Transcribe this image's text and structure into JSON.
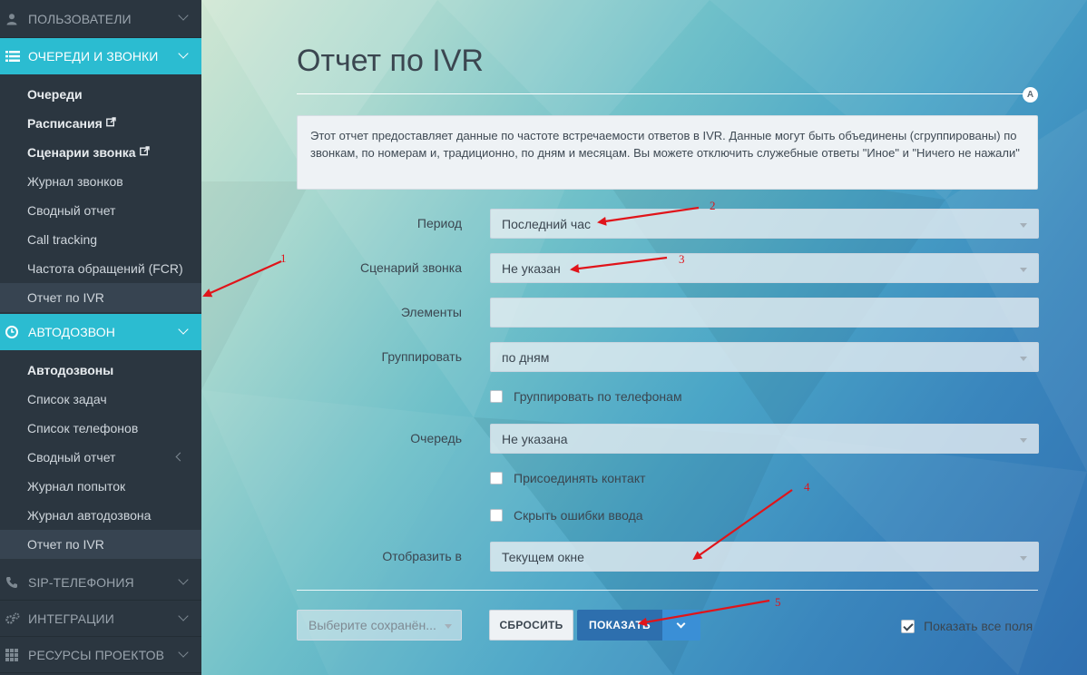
{
  "sidebar": {
    "sections": [
      {
        "label": "ПОЛЬЗОВАТЕЛИ",
        "icon": "user-icon"
      },
      {
        "label": "ОЧЕРЕДИ И ЗВОНКИ",
        "icon": "list-icon"
      },
      {
        "label": "АВТОДОЗВОН",
        "icon": "clock-icon"
      },
      {
        "label": "SIP-ТЕЛЕФОНИЯ",
        "icon": "phone-icon"
      },
      {
        "label": "ИНТЕГРАЦИИ",
        "icon": "cogs-icon"
      },
      {
        "label": "РЕСУРСЫ ПРОЕКТОВ",
        "icon": "grid-icon"
      }
    ],
    "queues_items": [
      "Очереди",
      "Расписания",
      "Сценарии звонка",
      "Журнал звонков",
      "Сводный отчет",
      "Call tracking",
      "Частота обращений (FCR)",
      "Отчет по IVR"
    ],
    "autodial_items": [
      "Автодозвоны",
      "Список задач",
      "Список телефонов",
      "Сводный отчет",
      "Журнал попыток",
      "Журнал автодозвона",
      "Отчет по IVR"
    ],
    "external_link_icon": "external-link-icon"
  },
  "page": {
    "title": "Отчет по IVR",
    "badge": "A",
    "description": "Этот отчет предоставляет данные по частоте встречаемости ответов в IVR. Данные могут быть объединены (сгруппированы) по звонкам, по номерам и, традиционно, по дням и месяцам. Вы можете отключить служебные ответы \"Иное\" и \"Ничего не нажали\""
  },
  "form": {
    "period_label": "Период",
    "period_value": "Последний час",
    "scenario_label": "Сценарий звонка",
    "scenario_value": "Не указан",
    "elements_label": "Элементы",
    "elements_value": "",
    "group_label": "Группировать",
    "group_value": "по дням",
    "group_by_phone": "Группировать по телефонам",
    "queue_label": "Очередь",
    "queue_value": "Не указана",
    "attach_contact": "Присоединять контакт",
    "hide_errors": "Скрыть ошибки ввода",
    "display_label": "Отобразить в",
    "display_value": "Текущем окне"
  },
  "actions": {
    "saved_placeholder": "Выберите сохранён...",
    "reset": "СБРОСИТЬ",
    "show": "ПОКАЗАТЬ",
    "show_all_fields": "Показать все поля"
  },
  "annotations": [
    "1",
    "2",
    "3",
    "4",
    "5"
  ],
  "colors": {
    "sidebar_bg": "#2b3640",
    "active_section": "#2bbcd1",
    "primary_button": "#2d6fae",
    "primary_dropdown": "#3a8fd6",
    "annotation_red": "#e0141a"
  }
}
